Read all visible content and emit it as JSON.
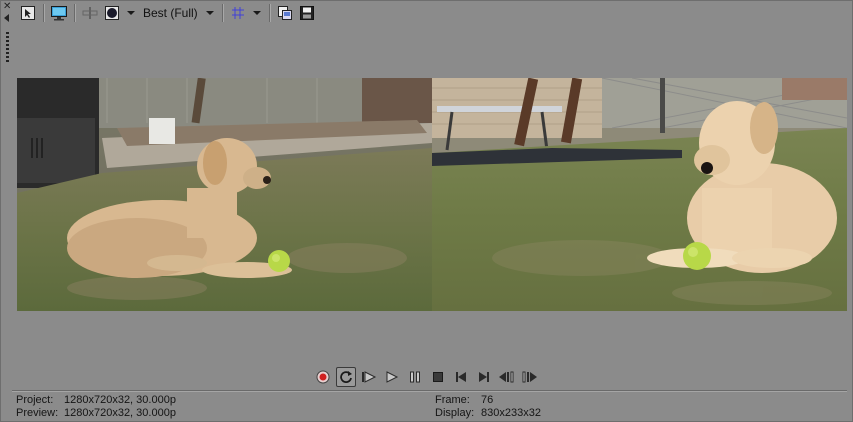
{
  "toolbar": {
    "quality_label": "Best (Full)",
    "icons": [
      "select-tool-icon",
      "external-monitor-icon",
      "split-screen-icon",
      "overlay-icon",
      "grid-icon",
      "copy-snapshot-icon",
      "save-snapshot-icon"
    ]
  },
  "preview": {
    "left_panel": "original clip",
    "right_panel": "processed clip"
  },
  "transport": {
    "icons": [
      "record-icon",
      "loop-icon",
      "play-from-start-icon",
      "play-icon",
      "pause-icon",
      "stop-icon",
      "previous-frame-icon",
      "next-frame-icon",
      "previous-marker-icon",
      "next-marker-icon"
    ]
  },
  "status": {
    "project_label": "Project:",
    "project_value": "1280x720x32, 30.000p",
    "preview_label": "Preview:",
    "preview_value": "1280x720x32, 30.000p",
    "frame_label": "Frame:",
    "frame_value": "76",
    "display_label": "Display:",
    "display_value": "830x233x32"
  },
  "colors": {
    "background": "#8b8b8b",
    "record": "#d02020",
    "grid_icon": "#3a3ad0",
    "tennis_ball": "#b8d848"
  }
}
